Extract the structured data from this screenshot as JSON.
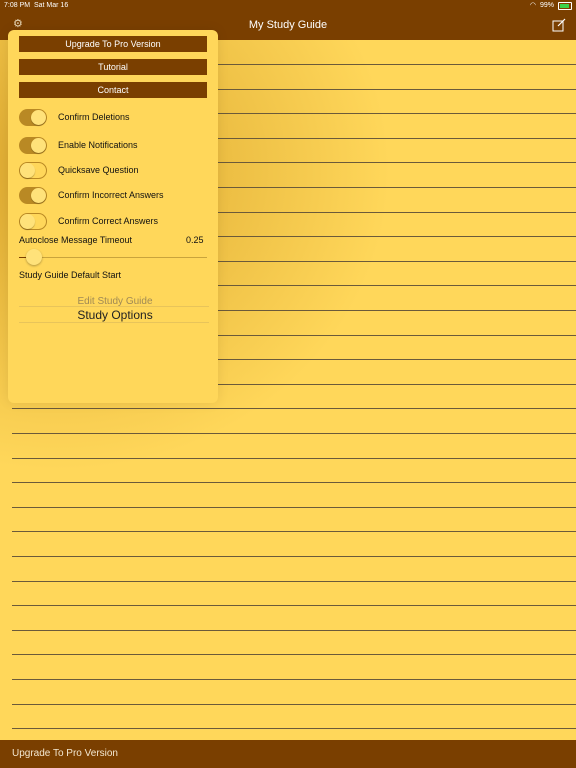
{
  "status": {
    "time": "7:08 PM",
    "date": "Sat Mar 16",
    "battery": "99%"
  },
  "nav": {
    "title": "My Study Guide",
    "left_icon": "gear-icon",
    "right_icon": "compose-icon"
  },
  "bottom": {
    "label": "Upgrade To Pro Version"
  },
  "menu": {
    "buttons": [
      "Upgrade To Pro Version",
      "Tutorial",
      "Contact"
    ],
    "toggles": [
      {
        "label": "Confirm Deletions",
        "on": true
      },
      {
        "label": "Enable Notifications",
        "on": true
      },
      {
        "label": "Quicksave Question",
        "on": false
      },
      {
        "label": "Confirm Incorrect Answers",
        "on": true
      },
      {
        "label": "Confirm Correct Answers",
        "on": false
      }
    ],
    "timeout": {
      "label": "Autoclose Message Timeout",
      "value": "0.25",
      "fraction": 0.05
    },
    "default_start": {
      "label": "Study Guide Default Start"
    },
    "picker": {
      "above": "Edit Study Guide",
      "selected": "Study Options"
    }
  },
  "colors": {
    "brand": "#7a3f00",
    "paper": "#ffd75a",
    "toggle_on": "#b98924"
  }
}
